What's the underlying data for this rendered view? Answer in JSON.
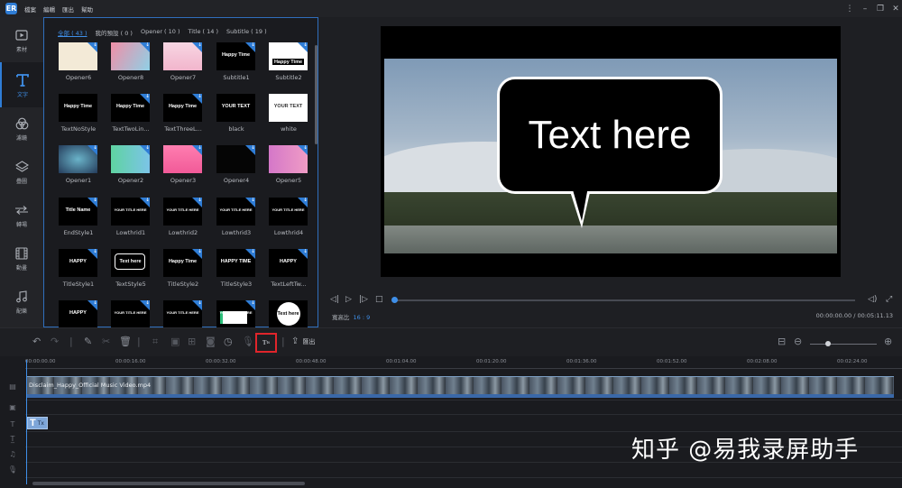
{
  "app": {
    "logo": "ER",
    "menu": [
      "檔案",
      "編輯",
      "匯出",
      "幫助"
    ],
    "window_controls": [
      "more-icon",
      "minimize-icon",
      "restore-icon",
      "close-icon"
    ]
  },
  "rail": {
    "items": [
      {
        "label": "素材",
        "icon": "media-icon"
      },
      {
        "label": "文字",
        "icon": "text-icon"
      },
      {
        "label": "濾鏡",
        "icon": "filter-icon"
      },
      {
        "label": "疊圖",
        "icon": "overlay-icon"
      },
      {
        "label": "轉場",
        "icon": "transition-icon"
      },
      {
        "label": "動畫",
        "icon": "animation-icon"
      },
      {
        "label": "配樂",
        "icon": "music-icon"
      }
    ],
    "active": "文字"
  },
  "library": {
    "tabs": [
      "全部 ( 43 )",
      "我的預設 ( 0 )",
      "Opener ( 10 )",
      "Title ( 14 )",
      "Subtitle ( 19 )"
    ],
    "tiles": [
      {
        "label": "Opener6",
        "text": ""
      },
      {
        "label": "Opener8",
        "text": ""
      },
      {
        "label": "Opener7",
        "text": ""
      },
      {
        "label": "Subtitle1",
        "text": "Happy Time"
      },
      {
        "label": "Subtitle2",
        "text": "Happy Time"
      },
      {
        "label": "TextNoStyle",
        "text": "Happy Time"
      },
      {
        "label": "TextTwoLin...",
        "text": "Happy Time"
      },
      {
        "label": "TextThreeL...",
        "text": "Happy Time"
      },
      {
        "label": "black",
        "text": "YOUR TEXT"
      },
      {
        "label": "white",
        "text": "YOUR TEXT"
      },
      {
        "label": "Opener1",
        "text": ""
      },
      {
        "label": "Opener2",
        "text": ""
      },
      {
        "label": "Opener3",
        "text": ""
      },
      {
        "label": "Opener4",
        "text": ""
      },
      {
        "label": "Opener5",
        "text": ""
      },
      {
        "label": "EndStyle1",
        "text": "Title Name"
      },
      {
        "label": "Lowthrid1",
        "text": "YOUR TITLE HERE"
      },
      {
        "label": "Lowthrid2",
        "text": "YOUR TITLE HERE"
      },
      {
        "label": "Lowthrid3",
        "text": "YOUR TITLE HERE"
      },
      {
        "label": "Lowthrid4",
        "text": "YOUR TITLE HERE"
      },
      {
        "label": "TitleStyle1",
        "text": "HAPPY"
      },
      {
        "label": "TextStyle5",
        "text": "Text here"
      },
      {
        "label": "TitleStyle2",
        "text": "Happy Time"
      },
      {
        "label": "TitleStyle3",
        "text": "HAPPY TIME"
      },
      {
        "label": "TextLeftTw...",
        "text": "HAPPY"
      },
      {
        "label": "",
        "text": "HAPPY"
      },
      {
        "label": "",
        "text": "YOUR TITLE HERE"
      },
      {
        "label": "",
        "text": "YOUR TITLE HERE"
      },
      {
        "label": "",
        "text": "YOUR TITLE HERE"
      },
      {
        "label": "",
        "text": "Text here"
      }
    ]
  },
  "preview": {
    "bubble_text": "Text here",
    "ratio_label": "寬高比",
    "ratio_value": "16 : 9",
    "time": "00:00:00.00 / 00:05:11.13",
    "progress": 0.0
  },
  "toolbar": {
    "tts_label": "T",
    "export_label": "匯出"
  },
  "timeline": {
    "ticks": [
      "00:00:00.00",
      "00:00:16.00",
      "00:00:32.00",
      "00:00:48.00",
      "00:01:04.00",
      "00:01:20.00",
      "00:01:36.00",
      "00:01:52.00",
      "00:02:08.00",
      "00:02:24.00"
    ],
    "video_clip_label": "Disclaim_Happy_Official Music Video.mp4",
    "text_clip_label": "Tx"
  },
  "watermark": "知乎 @易我录屏助手",
  "colors": {
    "accent": "#2f7dd6",
    "highlight": "#e0252b"
  }
}
